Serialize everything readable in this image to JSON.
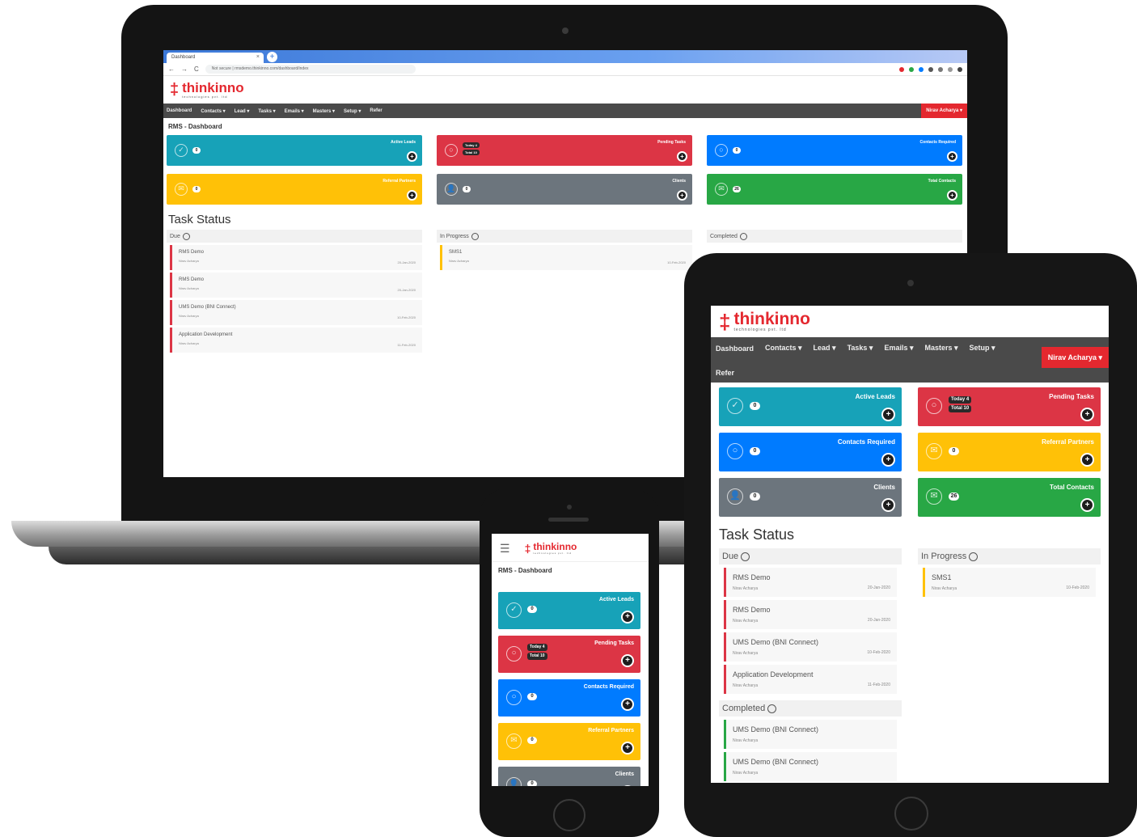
{
  "browser": {
    "tab_title": "Dashboard",
    "tab_close": "×",
    "new_tab": "+",
    "nav_back": "←",
    "nav_forward": "→",
    "nav_reload": "C",
    "address": "Not secure | rmsdemo.thinkinno.com/dashboard/index"
  },
  "brand": {
    "mark": "‡",
    "name": "thinkinno",
    "tagline": "technologies pvt. ltd"
  },
  "nav": {
    "items": [
      "Dashboard",
      "Contacts ▾",
      "Lead ▾",
      "Tasks ▾",
      "Emails ▾",
      "Masters ▾",
      "Setup ▾",
      "Refer"
    ],
    "user": "Nirav Acharya ▾"
  },
  "page": {
    "title": "RMS - Dashboard"
  },
  "tiles": {
    "active_leads": {
      "label": "Active Leads",
      "count": "0",
      "icon": "✓"
    },
    "pending_tasks": {
      "label": "Pending Tasks",
      "today": "Today 4",
      "total": "Total 10",
      "icon": "○"
    },
    "contacts_required": {
      "label": "Contacts Required",
      "count": "0",
      "icon": "○"
    },
    "referral_partners": {
      "label": "Referral Partners",
      "count": "0",
      "icon": "✉"
    },
    "clients": {
      "label": "Clients",
      "count": "0",
      "icon": "👤"
    },
    "total_contacts": {
      "label": "Total Contacts",
      "count": "26",
      "icon": "✉"
    },
    "go": "+"
  },
  "tasks": {
    "title": "Task Status",
    "due_label": "Due",
    "in_progress_label": "In Progress",
    "completed_label": "Completed",
    "due": [
      {
        "name": "RMS Demo",
        "sub": "Nirav Acharya",
        "date": "20-Jan-2020"
      },
      {
        "name": "RMS Demo",
        "sub": "Nirav Acharya",
        "date": "20-Jan-2020"
      },
      {
        "name": "UMS Demo (BNI Connect)",
        "sub": "Nirav Acharya",
        "date": "10-Feb-2020"
      },
      {
        "name": "Application Development",
        "sub": "Nirav Acharya",
        "date": "11-Feb-2020"
      }
    ],
    "in_progress": [
      {
        "name": "SMS1",
        "sub": "Nirav Acharya",
        "date": "10-Feb-2020"
      }
    ],
    "completed": [
      {
        "name": "UMS Demo (BNI Connect)",
        "sub": "Nirav Acharya"
      },
      {
        "name": "UMS Demo (BNI Connect)",
        "sub": "Nirav Acharya"
      }
    ]
  },
  "phone": {
    "menu_icon": "☰"
  },
  "colors": {
    "brand_red": "#e4282f",
    "teal": "#17a2b8",
    "red": "#dc3545",
    "blue": "#007bff",
    "yellow": "#ffc107",
    "gray": "#6c757d",
    "green": "#28a745",
    "navbar": "#4a4a4a"
  }
}
